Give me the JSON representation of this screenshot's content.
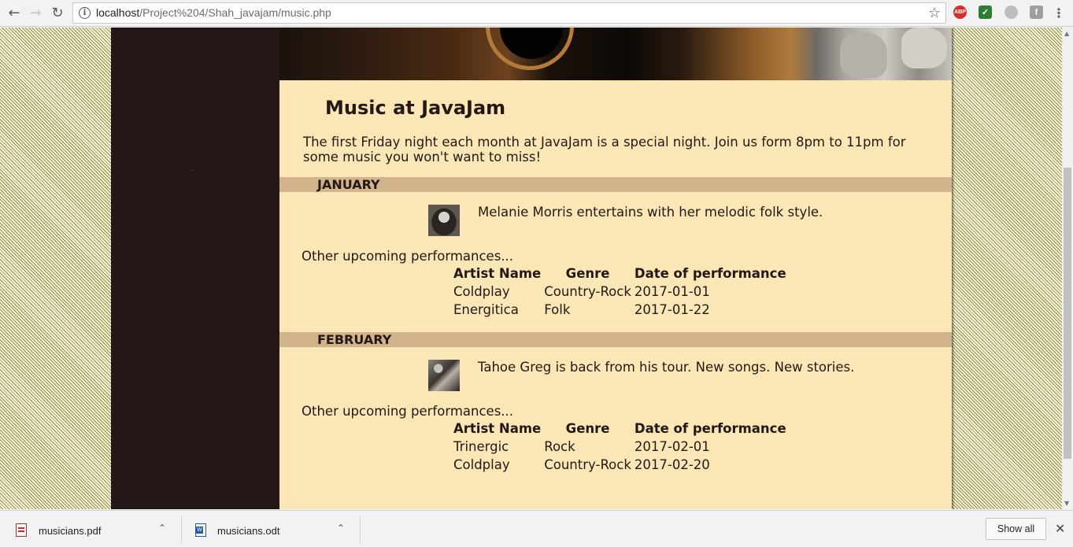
{
  "browser": {
    "url_host": "localhost",
    "url_path": "/Project%204/Shah_javajam/music.php",
    "back_icon": "arrow-left",
    "forward_icon": "arrow-right",
    "reload_icon": "reload",
    "info_icon": "info",
    "bookmark_icon": "star",
    "extensions": [
      {
        "name": "adblock-plus",
        "label": "ABP",
        "color": "#d32f2f"
      },
      {
        "name": "checklist",
        "label": "✓",
        "color": "#2e7d32"
      },
      {
        "name": "circle-ext",
        "label": "",
        "color": "#9e9e9e"
      },
      {
        "name": "font-ext",
        "label": "f",
        "color": "#9e9e9e"
      }
    ]
  },
  "page": {
    "title": "Music at JavaJam",
    "intro": "The first Friday night each month at JavaJam is a special night. Join us form 8pm to 11pm for some music you won't want to miss!",
    "other_label": "Other upcoming performances...",
    "table_headers": [
      "Artist Name",
      "Genre",
      "Date of performance"
    ],
    "months": [
      {
        "name": "JANUARY",
        "featured": "Melanie Morris entertains with her melodic folk style.",
        "thumb": "melanie-morris-photo",
        "rows": [
          [
            "Coldplay",
            "Country-Rock",
            "2017-01-01"
          ],
          [
            "Energitica",
            "Folk",
            "2017-01-22"
          ]
        ]
      },
      {
        "name": "FEBRUARY",
        "featured": "Tahoe Greg is back from his tour. New songs. New stories.",
        "thumb": "tahoe-greg-photo",
        "rows": [
          [
            "Trinergic",
            "Rock",
            "2017-02-01"
          ],
          [
            "Coldplay",
            "Country-Rock",
            "2017-02-20"
          ]
        ]
      }
    ],
    "colors": {
      "background_stripe_light": "#f7f5dc",
      "background_stripe_dark": "#8e8a42",
      "content_bg": "#fae7b5",
      "sidebar_bg": "#231815",
      "month_bar": "#d2b48c",
      "text": "#231815"
    }
  },
  "downloads": {
    "items": [
      {
        "name": "musicians.pdf",
        "icon": "pdf-file"
      },
      {
        "name": "musicians.odt",
        "icon": "word-document"
      }
    ],
    "show_all": "Show all",
    "close_icon": "close"
  }
}
